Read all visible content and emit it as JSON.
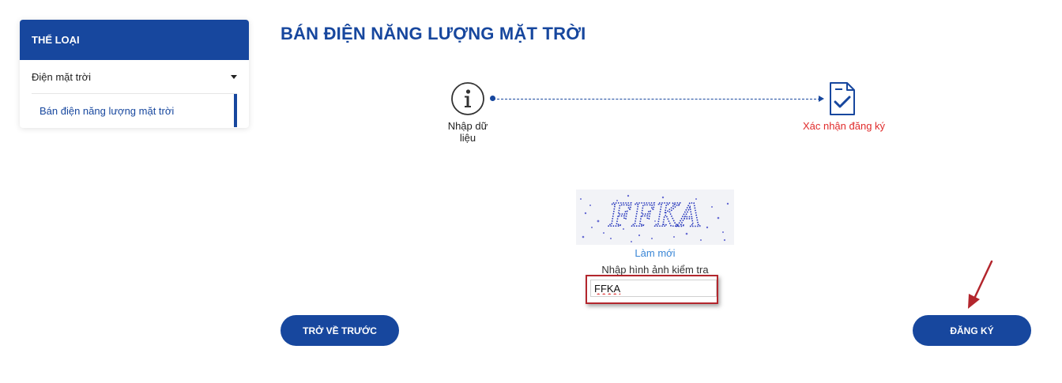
{
  "sidebar": {
    "header": "THỂ LOẠI",
    "category": "Điện mặt trời",
    "subitem": "Bán điện năng lượng mặt trời"
  },
  "page": {
    "title": "BÁN ĐIỆN NĂNG LƯỢNG MẶT TRỜI"
  },
  "steps": [
    {
      "label": "Nhập dữ liệu",
      "icon": "info-icon",
      "color": "#222222"
    },
    {
      "label": "Xác nhận đăng ký",
      "icon": "document-check-icon",
      "color": "#e02b2b"
    }
  ],
  "captcha": {
    "image_text": "FFKA",
    "refresh_label": "Làm mới",
    "prompt": "Nhập hình ảnh kiểm tra",
    "input_value": "FFKA"
  },
  "buttons": {
    "back": "TRỞ VỀ TRƯỚC",
    "register": "ĐĂNG KÝ"
  },
  "colors": {
    "primary": "#17479e",
    "accent_red": "#e02b2b",
    "link": "#3a86d6",
    "highlight_box": "#b3262d"
  }
}
